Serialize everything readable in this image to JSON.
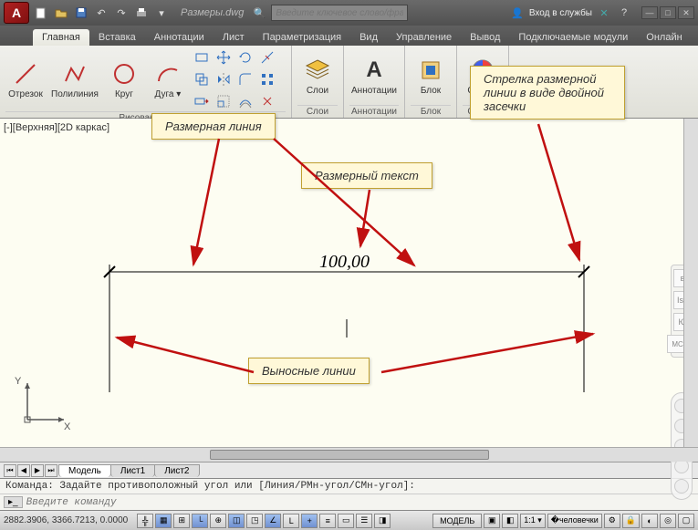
{
  "app": {
    "logo_letter": "A",
    "document": "Размеры.dwg"
  },
  "search": {
    "placeholder": "Введите ключевое слово/фразу"
  },
  "title_actions": {
    "signin": "Вход в службы"
  },
  "tabs": [
    "Главная",
    "Вставка",
    "Аннотации",
    "Лист",
    "Параметризация",
    "Вид",
    "Управление",
    "Вывод",
    "Подключаемые модули",
    "Онлайн"
  ],
  "active_tab_index": 0,
  "ribbon": {
    "draw": {
      "title": "Рисование ▾",
      "buttons": {
        "line": "Отрезок",
        "polyline": "Полилиния",
        "circle": "Круг",
        "arc": "Дуга ▾"
      }
    },
    "layer": {
      "title": "Слои",
      "label": "Слои"
    },
    "annot": {
      "title": "Аннотации",
      "label": "Аннотации"
    },
    "block": {
      "title": "Блок",
      "label": "Блок"
    },
    "props": {
      "title": "Свойст",
      "label": "Свойст"
    }
  },
  "view_label": "[-][Верхняя][2D каркас]",
  "dimension": {
    "value": "100,00"
  },
  "callouts": {
    "dimline": "Размерная линия",
    "dimtext": "Размерный текст",
    "arrowtype": "Стрелка размерной линии в виде двойной засечки",
    "extlines": "Выносные линии"
  },
  "axes": {
    "x": "X",
    "y": "Y"
  },
  "layout_tabs": {
    "model": "Модель",
    "sheet1": "Лист1",
    "sheet2": "Лист2"
  },
  "command": {
    "history": "Команда: Задайте противоположный угол или [Линия/РМн-угол/СМн-угол]:",
    "placeholder": "Введите команду"
  },
  "status": {
    "coords": "2882.3906, 3366.7213, 0.0000",
    "model_btn": "МОДЕЛЬ",
    "scale": "1:1 ▾"
  },
  "viewcube": {
    "top": "в",
    "iso": "Isо",
    "front": "Ю",
    "wcs": "МСК ▾"
  }
}
